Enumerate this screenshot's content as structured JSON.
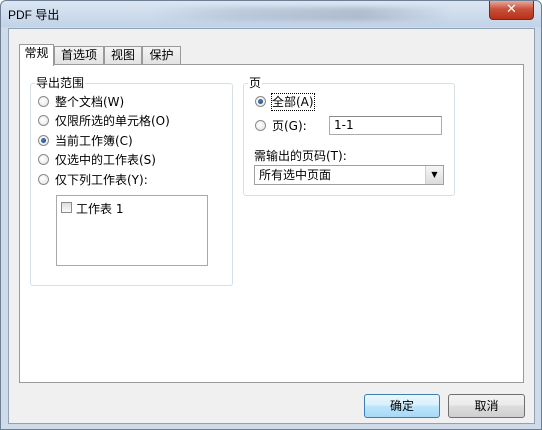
{
  "window": {
    "title": "PDF 导出",
    "close_label": "✕"
  },
  "tabs": [
    {
      "label": "常规",
      "active": true
    },
    {
      "label": "首选项",
      "active": false
    },
    {
      "label": "视图",
      "active": false
    },
    {
      "label": "保护",
      "active": false
    }
  ],
  "export_range": {
    "legend": "导出范围",
    "options": [
      {
        "label": "整个文档(W)",
        "checked": false
      },
      {
        "label": "仅限所选的单元格(O)",
        "checked": false
      },
      {
        "label": "当前工作簿(C)",
        "checked": true
      },
      {
        "label": "仅选中的工作表(S)",
        "checked": false
      },
      {
        "label": "仅下列工作表(Y):",
        "checked": false
      }
    ],
    "sheet_list": [
      {
        "label": "工作表 1",
        "checked": false
      }
    ]
  },
  "pages": {
    "legend": "页",
    "all_label": "全部(A)",
    "all_checked": true,
    "pages_label": "页(G):",
    "pages_checked": false,
    "pages_value": "1-1",
    "output_label": "需输出的页码(T):",
    "output_selected": "所有选中页面"
  },
  "buttons": {
    "ok": "确定",
    "cancel": "取消"
  }
}
